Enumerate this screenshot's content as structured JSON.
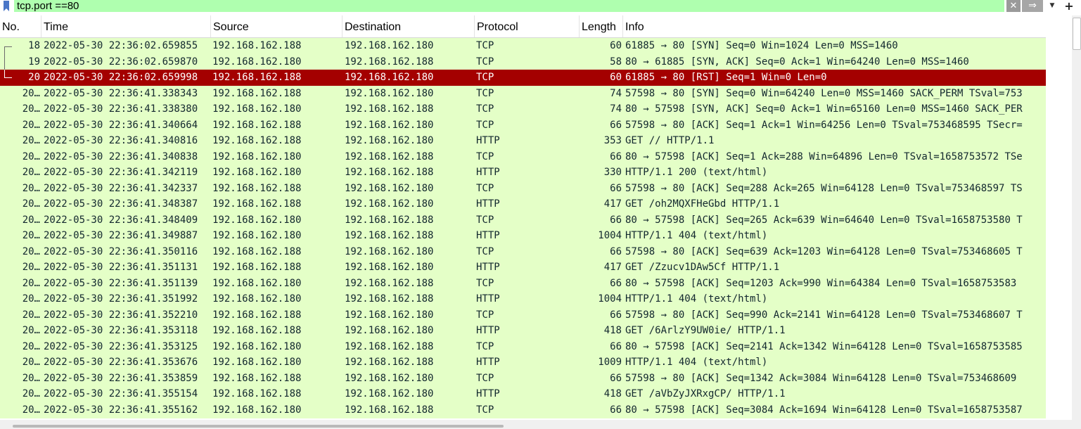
{
  "filter": {
    "value": "tcp.port ==80",
    "bookmark_icon": "bookmark-icon",
    "clear_icon": "✕",
    "apply_icon": "⇒",
    "dropdown_icon": "▼",
    "add_icon": "+"
  },
  "columns": [
    "No.",
    "Time",
    "Source",
    "Destination",
    "Protocol",
    "Length",
    "Info"
  ],
  "colors": {
    "row_bg": "#e4ffc7",
    "selected_bg": "#a40000",
    "filter_bg": "#afffaf"
  },
  "selected_row_index": 2,
  "packets": [
    {
      "no": "18",
      "time": "2022-05-30 22:36:02.659855",
      "src": "192.168.162.188",
      "dst": "192.168.162.180",
      "proto": "TCP",
      "len": "60",
      "info": "61885 → 80 [SYN] Seq=0 Win=1024 Len=0 MSS=1460"
    },
    {
      "no": "19",
      "time": "2022-05-30 22:36:02.659870",
      "src": "192.168.162.180",
      "dst": "192.168.162.188",
      "proto": "TCP",
      "len": "58",
      "info": "80 → 61885 [SYN, ACK] Seq=0 Ack=1 Win=64240 Len=0 MSS=1460"
    },
    {
      "no": "20",
      "time": "2022-05-30 22:36:02.659998",
      "src": "192.168.162.188",
      "dst": "192.168.162.180",
      "proto": "TCP",
      "len": "60",
      "info": "61885 → 80 [RST] Seq=1 Win=0 Len=0"
    },
    {
      "no": "20…",
      "time": "2022-05-30 22:36:41.338343",
      "src": "192.168.162.188",
      "dst": "192.168.162.180",
      "proto": "TCP",
      "len": "74",
      "info": "57598 → 80 [SYN] Seq=0 Win=64240 Len=0 MSS=1460 SACK_PERM TSval=753"
    },
    {
      "no": "20…",
      "time": "2022-05-30 22:36:41.338380",
      "src": "192.168.162.180",
      "dst": "192.168.162.188",
      "proto": "TCP",
      "len": "74",
      "info": "80 → 57598 [SYN, ACK] Seq=0 Ack=1 Win=65160 Len=0 MSS=1460 SACK_PER"
    },
    {
      "no": "20…",
      "time": "2022-05-30 22:36:41.340664",
      "src": "192.168.162.188",
      "dst": "192.168.162.180",
      "proto": "TCP",
      "len": "66",
      "info": "57598 → 80 [ACK] Seq=1 Ack=1 Win=64256 Len=0 TSval=753468595 TSecr="
    },
    {
      "no": "20…",
      "time": "2022-05-30 22:36:41.340816",
      "src": "192.168.162.188",
      "dst": "192.168.162.180",
      "proto": "HTTP",
      "len": "353",
      "info": "GET // HTTP/1.1"
    },
    {
      "no": "20…",
      "time": "2022-05-30 22:36:41.340838",
      "src": "192.168.162.180",
      "dst": "192.168.162.188",
      "proto": "TCP",
      "len": "66",
      "info": "80 → 57598 [ACK] Seq=1 Ack=288 Win=64896 Len=0 TSval=1658753572 TSe"
    },
    {
      "no": "20…",
      "time": "2022-05-30 22:36:41.342119",
      "src": "192.168.162.180",
      "dst": "192.168.162.188",
      "proto": "HTTP",
      "len": "330",
      "info": "HTTP/1.1 200   (text/html)"
    },
    {
      "no": "20…",
      "time": "2022-05-30 22:36:41.342337",
      "src": "192.168.162.188",
      "dst": "192.168.162.180",
      "proto": "TCP",
      "len": "66",
      "info": "57598 → 80 [ACK] Seq=288 Ack=265 Win=64128 Len=0 TSval=753468597 TS"
    },
    {
      "no": "20…",
      "time": "2022-05-30 22:36:41.348387",
      "src": "192.168.162.188",
      "dst": "192.168.162.180",
      "proto": "HTTP",
      "len": "417",
      "info": "GET /oh2MQXFHeGbd HTTP/1.1"
    },
    {
      "no": "20…",
      "time": "2022-05-30 22:36:41.348409",
      "src": "192.168.162.180",
      "dst": "192.168.162.188",
      "proto": "TCP",
      "len": "66",
      "info": "80 → 57598 [ACK] Seq=265 Ack=639 Win=64640 Len=0 TSval=1658753580 T"
    },
    {
      "no": "20…",
      "time": "2022-05-30 22:36:41.349887",
      "src": "192.168.162.180",
      "dst": "192.168.162.188",
      "proto": "HTTP",
      "len": "1004",
      "info": "HTTP/1.1 404   (text/html)"
    },
    {
      "no": "20…",
      "time": "2022-05-30 22:36:41.350116",
      "src": "192.168.162.188",
      "dst": "192.168.162.180",
      "proto": "TCP",
      "len": "66",
      "info": "57598 → 80 [ACK] Seq=639 Ack=1203 Win=64128 Len=0 TSval=753468605 T"
    },
    {
      "no": "20…",
      "time": "2022-05-30 22:36:41.351131",
      "src": "192.168.162.188",
      "dst": "192.168.162.180",
      "proto": "HTTP",
      "len": "417",
      "info": "GET /Zzucv1DAw5Cf HTTP/1.1"
    },
    {
      "no": "20…",
      "time": "2022-05-30 22:36:41.351139",
      "src": "192.168.162.180",
      "dst": "192.168.162.188",
      "proto": "TCP",
      "len": "66",
      "info": "80 → 57598 [ACK] Seq=1203 Ack=990 Win=64384 Len=0 TSval=1658753583"
    },
    {
      "no": "20…",
      "time": "2022-05-30 22:36:41.351992",
      "src": "192.168.162.180",
      "dst": "192.168.162.188",
      "proto": "HTTP",
      "len": "1004",
      "info": "HTTP/1.1 404   (text/html)"
    },
    {
      "no": "20…",
      "time": "2022-05-30 22:36:41.352210",
      "src": "192.168.162.188",
      "dst": "192.168.162.180",
      "proto": "TCP",
      "len": "66",
      "info": "57598 → 80 [ACK] Seq=990 Ack=2141 Win=64128 Len=0 TSval=753468607 T"
    },
    {
      "no": "20…",
      "time": "2022-05-30 22:36:41.353118",
      "src": "192.168.162.188",
      "dst": "192.168.162.180",
      "proto": "HTTP",
      "len": "418",
      "info": "GET /6ArlzY9UW0ie/ HTTP/1.1"
    },
    {
      "no": "20…",
      "time": "2022-05-30 22:36:41.353125",
      "src": "192.168.162.180",
      "dst": "192.168.162.188",
      "proto": "TCP",
      "len": "66",
      "info": "80 → 57598 [ACK] Seq=2141 Ack=1342 Win=64128 Len=0 TSval=1658753585"
    },
    {
      "no": "20…",
      "time": "2022-05-30 22:36:41.353676",
      "src": "192.168.162.180",
      "dst": "192.168.162.188",
      "proto": "HTTP",
      "len": "1009",
      "info": "HTTP/1.1 404   (text/html)"
    },
    {
      "no": "20…",
      "time": "2022-05-30 22:36:41.353859",
      "src": "192.168.162.188",
      "dst": "192.168.162.180",
      "proto": "TCP",
      "len": "66",
      "info": "57598 → 80 [ACK] Seq=1342 Ack=3084 Win=64128 Len=0 TSval=753468609"
    },
    {
      "no": "20…",
      "time": "2022-05-30 22:36:41.355154",
      "src": "192.168.162.188",
      "dst": "192.168.162.180",
      "proto": "HTTP",
      "len": "418",
      "info": "GET /aVbZyJXRxgCP/ HTTP/1.1"
    },
    {
      "no": "20…",
      "time": "2022-05-30 22:36:41.355162",
      "src": "192.168.162.180",
      "dst": "192.168.162.188",
      "proto": "TCP",
      "len": "66",
      "info": "80 → 57598 [ACK] Seq=3084 Ack=1694 Win=64128 Len=0 TSval=1658753587"
    }
  ]
}
